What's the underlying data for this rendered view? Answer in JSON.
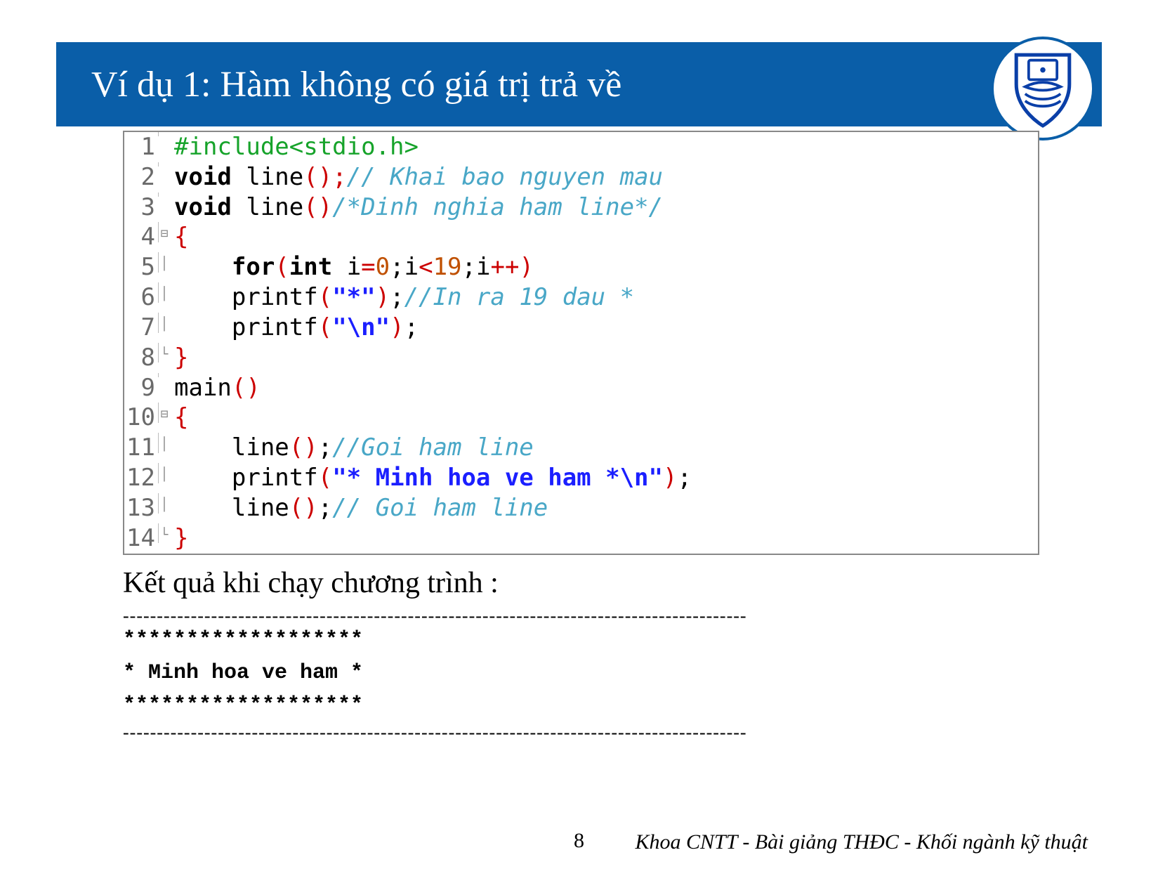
{
  "header": {
    "title": "Ví dụ 1: Hàm không có giá trị trả về"
  },
  "code_lines": [
    {
      "n": "1",
      "fold": "",
      "html": "<span class='pp'>#include&lt;stdio.h&gt;</span>"
    },
    {
      "n": "2",
      "fold": "",
      "html": "<span class='type'>void</span> line<span class='paren'>();</span><span class='com'>// Khai bao nguyen mau</span>"
    },
    {
      "n": "3",
      "fold": "",
      "html": "<span class='type'>void</span> line<span class='paren'>()</span><span class='com'>/*Dinh nghia ham line*/</span>"
    },
    {
      "n": "4",
      "fold": "⊟",
      "html": "<span class='sym'>{</span>"
    },
    {
      "n": "5",
      "fold": "│",
      "html": "    <span class='kw'>for</span><span class='paren'>(</span><span class='kw'>int</span> i<span class='sym'>=</span><span class='num'>0</span>;i<span class='sym'>&lt;</span><span class='num'>19</span>;i<span class='sym'>++</span><span class='paren'>)</span>"
    },
    {
      "n": "6",
      "fold": "│",
      "html": "    printf<span class='paren'>(</span><span class='str'>\"*\"</span><span class='paren'>)</span>;<span class='com'>//In ra 19 dau *</span>"
    },
    {
      "n": "7",
      "fold": "│",
      "html": "    printf<span class='paren'>(</span><span class='str'>\"\\n\"</span><span class='paren'>)</span>;"
    },
    {
      "n": "8",
      "fold": "└",
      "html": "<span class='sym'>}</span>"
    },
    {
      "n": "9",
      "fold": "",
      "html": "main<span class='paren'>()</span>"
    },
    {
      "n": "10",
      "fold": "⊟",
      "html": "<span class='sym'>{</span>"
    },
    {
      "n": "11",
      "fold": "│",
      "html": "    line<span class='paren'>()</span>;<span class='com'>//Goi ham line</span>"
    },
    {
      "n": "12",
      "fold": "│",
      "html": "    printf<span class='paren'>(</span><span class='str'>\"* Minh hoa ve ham *\\n\"</span><span class='paren'>)</span>;"
    },
    {
      "n": "13",
      "fold": "│",
      "html": "    line<span class='paren'>()</span>;<span class='com'>// Goi ham line</span>"
    },
    {
      "n": "14",
      "fold": "└",
      "html": "<span class='sym'>}</span>"
    }
  ],
  "result": {
    "heading": "Kết quả khi chạy chương trình :",
    "dashline": "--------------------------------------------------------------------------------------------",
    "output": "*******************\n* Minh hoa ve ham *\n*******************"
  },
  "footer": {
    "page": "8",
    "text": "Khoa CNTT - Bài giảng THĐC - Khối ngành kỹ thuật"
  }
}
